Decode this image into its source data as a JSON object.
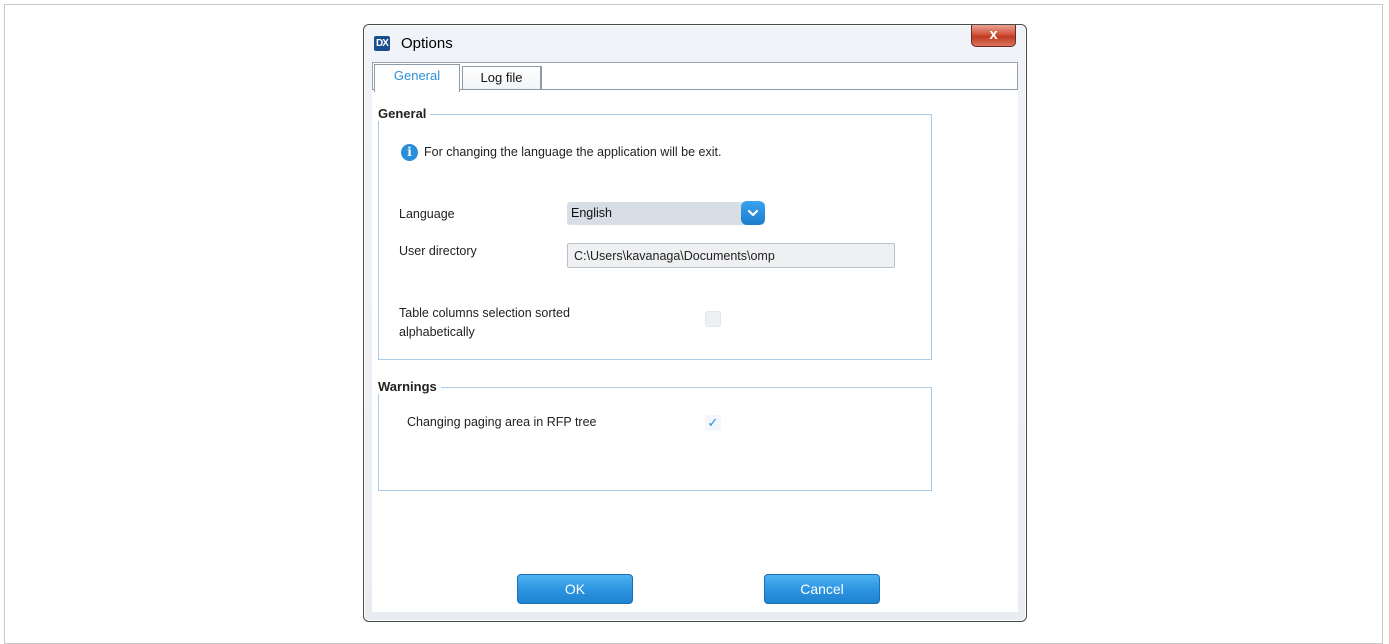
{
  "window": {
    "title": "Options",
    "app_icon_glyph": "DX",
    "close_glyph": "x"
  },
  "tabs": [
    {
      "label": "General",
      "active": true
    },
    {
      "label": "Log file",
      "active": false
    }
  ],
  "general_group": {
    "legend": "General",
    "info_text": "For changing the language the application will be exit.",
    "info_icon_glyph": "i",
    "language_label": "Language",
    "language_value": "English",
    "user_directory_label": "User directory",
    "user_directory_value": "C:\\Users\\kavanaga\\Documents\\omp",
    "table_columns_label_line1": "Table columns selection sorted",
    "table_columns_label_line2": "alphabetically",
    "table_columns_checked": false
  },
  "warnings_group": {
    "legend": "Warnings",
    "paging_label": "Changing paging area in RFP tree",
    "paging_checked": true,
    "check_glyph": "✓"
  },
  "buttons": {
    "ok_label": "OK",
    "cancel_label": "Cancel"
  },
  "colors": {
    "accent": "#2a8fd8",
    "group_border": "#a9cbe8",
    "close_red": "#c23a22"
  }
}
